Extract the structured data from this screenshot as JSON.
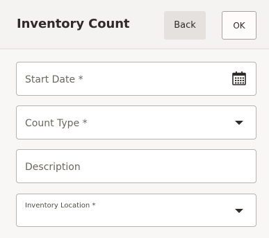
{
  "header": {
    "title": "Inventory Count",
    "back_label": "Back",
    "ok_label": "OK"
  },
  "form": {
    "start_date": {
      "label": "Start Date *",
      "value": "",
      "icon": "calendar-icon"
    },
    "count_type": {
      "label": "Count Type *",
      "value": "",
      "icon": "caret-down-icon"
    },
    "description": {
      "label": "Description",
      "value": ""
    },
    "inventory_location": {
      "label": "Inventory Location *",
      "value": "",
      "icon": "caret-down-icon"
    }
  }
}
